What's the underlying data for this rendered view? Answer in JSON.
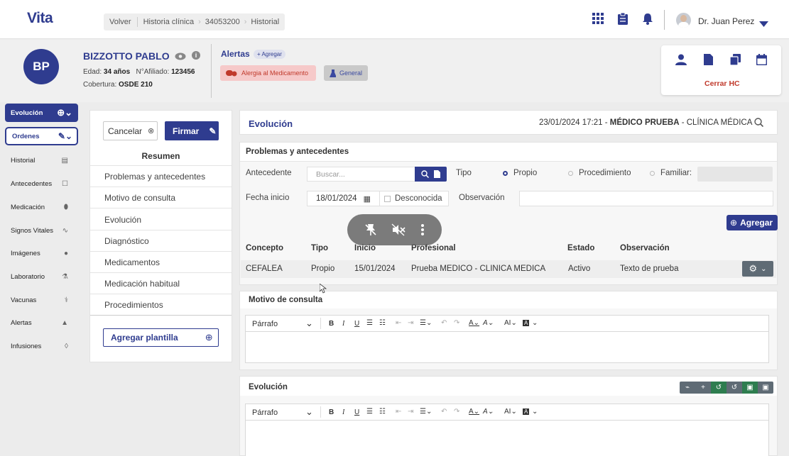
{
  "app": {
    "logo": "Vita"
  },
  "breadcrumb": {
    "back": "Volver",
    "items": [
      "Historia clínica",
      "34053200",
      "Historial"
    ]
  },
  "user": {
    "name": "Dr. Juan Perez"
  },
  "patient": {
    "initials": "BP",
    "name": "BIZZOTTO PABLO",
    "age_label": "Edad:",
    "age_value": "34 años",
    "affiliate_label": "N°Afiliado:",
    "affiliate_value": "123456",
    "coverage_label": "Cobertura:",
    "coverage_value": "OSDE 210"
  },
  "alerts": {
    "title": "Alertas",
    "add_label": "+ Agregar",
    "tags": [
      {
        "label": "Alergia al Medicamento",
        "color": "#f6c9c9",
        "text": "#c0392b"
      },
      {
        "label": "General",
        "color": "#c9c9c9",
        "text": "#3b4aa0"
      }
    ]
  },
  "actions": {
    "close_label": "Cerrar HC"
  },
  "sidebar": {
    "items": [
      {
        "label": "Evolución",
        "icon": "file-plus-icon",
        "glyph": "⊕"
      },
      {
        "label": "Ordenes",
        "icon": "edit-icon",
        "glyph": "✎"
      },
      {
        "label": "Historial",
        "icon": "document-icon",
        "glyph": "▤"
      },
      {
        "label": "Antecedentes",
        "icon": "checkbox-icon",
        "glyph": "☐"
      },
      {
        "label": "Medicación",
        "icon": "pill-icon",
        "glyph": "⬮"
      },
      {
        "label": "Signos Vitales",
        "icon": "pulse-icon",
        "glyph": "∿"
      },
      {
        "label": "Imágenes",
        "icon": "image-icon",
        "glyph": "●"
      },
      {
        "label": "Laboratorio",
        "icon": "flask-icon",
        "glyph": "⚗"
      },
      {
        "label": "Vacunas",
        "icon": "syringe-icon",
        "glyph": "⚕"
      },
      {
        "label": "Alertas",
        "icon": "warning-icon",
        "glyph": "▲"
      },
      {
        "label": "Infusiones",
        "icon": "drip-icon",
        "glyph": "◊"
      }
    ]
  },
  "summary": {
    "cancel_label": "Cancelar",
    "sign_label": "Firmar",
    "title": "Resumen",
    "items": [
      "Problemas y antecedentes",
      "Motivo de consulta",
      "Evolución",
      "Diagnóstico",
      "Medicamentos",
      "Medicación habitual",
      "Procedimientos"
    ],
    "template_label": "Agregar plantilla"
  },
  "evolution_header": {
    "title": "Evolución",
    "datetime": "23/01/2024 17:21 - ",
    "doctor": "MÉDICO PRUEBA",
    "specialty": " - CLÍNICA MÉDICA"
  },
  "problems": {
    "title": "Problemas y antecedentes",
    "antecedente_label": "Antecedente",
    "search_placeholder": "Buscar...",
    "tipo_label": "Tipo",
    "tipo_options": [
      "Propio",
      "Procedimiento",
      "Familiar:"
    ],
    "fecha_label": "Fecha inicio",
    "fecha_value": "18/01/2024",
    "desconocida_label": "Desconocida",
    "observacion_label": "Observación",
    "add_label": "Agregar",
    "table": {
      "headers": [
        "Concepto",
        "Tipo",
        "Inicio",
        "Profesional",
        "Estado",
        "Observación"
      ],
      "rows": [
        [
          "CEFALEA",
          "Propio",
          "15/01/2024",
          "Prueba MEDICO - CLINICA MEDICA",
          "Activo",
          "Texto de prueba"
        ]
      ]
    }
  },
  "motivo": {
    "title": "Motivo de consulta",
    "paragraph_label": "Párrafo"
  },
  "evolucion": {
    "title": "Evolución",
    "paragraph_label": "Párrafo"
  },
  "colors": {
    "primary": "#2f3c8f",
    "green": "#2e7d4f",
    "grey_button": "#5f6b75"
  }
}
